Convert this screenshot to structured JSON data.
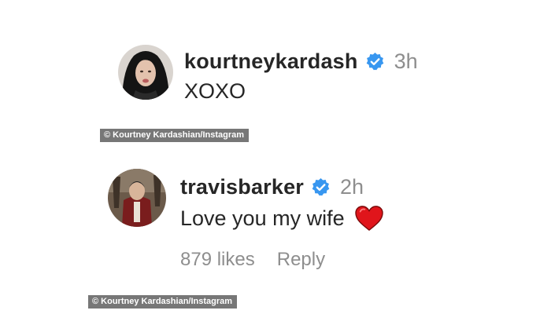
{
  "comments": [
    {
      "username": "kourtneykardash",
      "verified": true,
      "time": "3h",
      "text": "XOXO",
      "avatar_icon": "profile-photo-avatar"
    },
    {
      "username": "travisbarker",
      "verified": true,
      "time": "2h",
      "text": "Love you my wife",
      "emoji": "red-heart-icon",
      "avatar_icon": "profile-photo-avatar",
      "likes": "879 likes",
      "reply_label": "Reply"
    }
  ],
  "credits": [
    "© Kourtney Kardashian/Instagram",
    "© Kourtney Kardashian/Instagram"
  ],
  "colors": {
    "verified_badge": "#3897f0",
    "username": "#262626",
    "meta": "#8e8e8e",
    "heart": "#e0151b",
    "credit_bg": "#777777"
  }
}
